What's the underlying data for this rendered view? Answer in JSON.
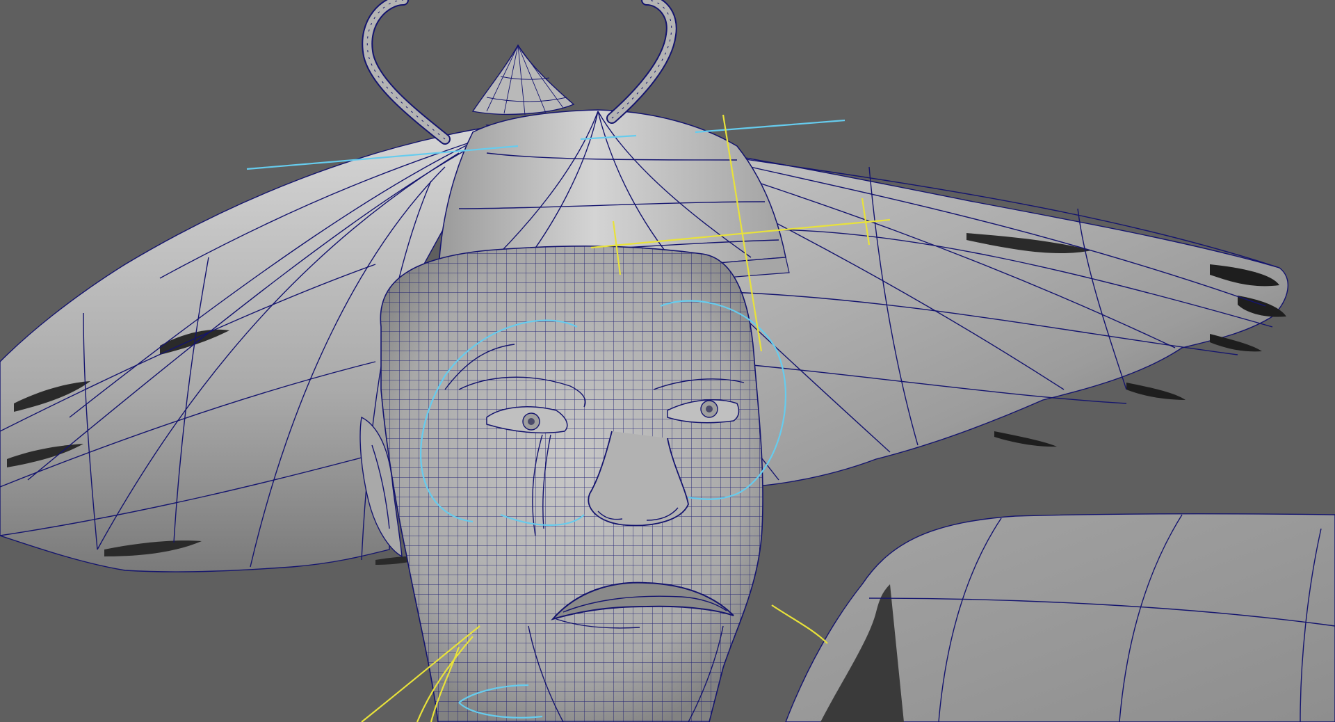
{
  "viewport": {
    "background": "#5f5f5f",
    "shading": "wireframe-on-shaded",
    "wire_color": "#14146e",
    "surface_color": "#b4b4b4",
    "controls": {
      "cyan": "#66ccee",
      "yellow": "#e8e23a"
    },
    "objects": [
      "hat-ring",
      "hat-finial",
      "hat-cone",
      "hat-brim",
      "head",
      "ear",
      "shoulder",
      "eye-controls",
      "brow-controls",
      "hat-controls",
      "jaw-controls"
    ]
  }
}
